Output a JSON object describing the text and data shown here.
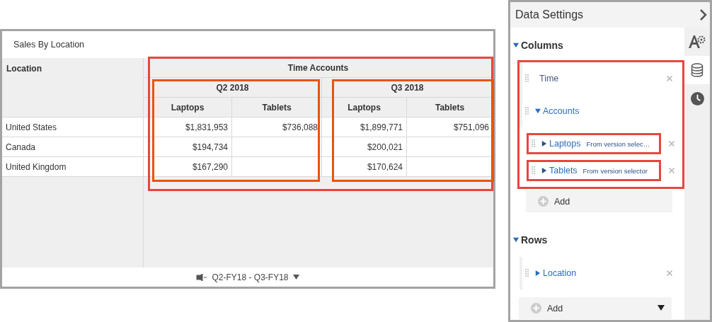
{
  "card": {
    "title": "Sales By Location",
    "table": {
      "row_header": "Location",
      "column_header": {
        "label": "Time Accounts",
        "highlighted": true
      },
      "groups": [
        {
          "label": "Q2 2018",
          "highlighted": true,
          "columns": [
            "Laptops",
            "Tablets"
          ]
        },
        {
          "label": "Q3 2018",
          "highlighted": true,
          "columns": [
            "Laptops",
            "Tablets"
          ]
        }
      ],
      "rows": [
        {
          "label": "United States",
          "cells": [
            "$1,831,953",
            "$736,088",
            "$1,899,771",
            "$751,096"
          ]
        },
        {
          "label": "Canada",
          "cells": [
            "$194,734",
            null,
            "$200,021",
            null
          ]
        },
        {
          "label": "United Kingdom",
          "cells": [
            "$167,290",
            null,
            "$170,624",
            null
          ]
        }
      ]
    },
    "footer": {
      "range": "Q2-FY18 - Q3-FY18"
    }
  },
  "panel": {
    "title": "Data Settings",
    "side_tabs": [
      {
        "kind": "styling",
        "selected": false
      },
      {
        "kind": "data",
        "selected": true
      },
      {
        "kind": "history",
        "selected": false
      }
    ],
    "sections": [
      {
        "title": "Columns",
        "expanded": true,
        "highlighted": true,
        "add_label": "Add",
        "add_menu": false,
        "items": [
          {
            "label": "Time",
            "kind": "plain",
            "removable": true,
            "highlighted": false
          },
          {
            "label": "Accounts",
            "kind": "toggle",
            "expanded": true,
            "removable": false,
            "highlighted": false,
            "children": [
              {
                "label": "Laptops",
                "kind": "toggle",
                "expanded": false,
                "note": "From version selec…",
                "removable": true,
                "highlighted": true
              },
              {
                "label": "Tablets",
                "kind": "toggle",
                "expanded": false,
                "note": "From version selector",
                "removable": true,
                "highlighted": true
              }
            ]
          }
        ]
      },
      {
        "title": "Rows",
        "expanded": true,
        "highlighted": false,
        "add_label": "Add",
        "add_menu": true,
        "items": [
          {
            "label": "Location",
            "kind": "toggle",
            "expanded": false,
            "removable": true,
            "highlighted": false
          }
        ]
      }
    ]
  }
}
